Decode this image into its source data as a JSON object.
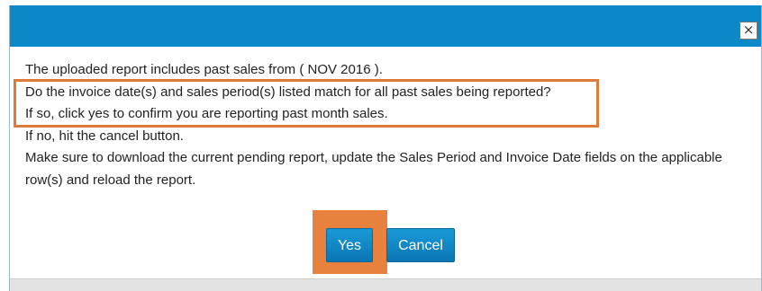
{
  "dialog": {
    "close_label": "×",
    "lines": [
      "The uploaded report includes past sales from ( NOV 2016 ).",
      "Do the invoice date(s) and sales period(s) listed match for all past sales being reported?",
      "If so, click yes to confirm you are reporting past month sales.",
      "If no, hit the cancel button.",
      "Make sure to download the current pending report, update the Sales Period and Invoice Date fields on the applicable",
      "row(s) and reload the report."
    ],
    "buttons": {
      "yes_label": "Yes",
      "cancel_label": "Cancel"
    }
  },
  "colors": {
    "titlebar": "#0b88c7",
    "button": "#0a85c4",
    "highlight": "#e07a38"
  }
}
